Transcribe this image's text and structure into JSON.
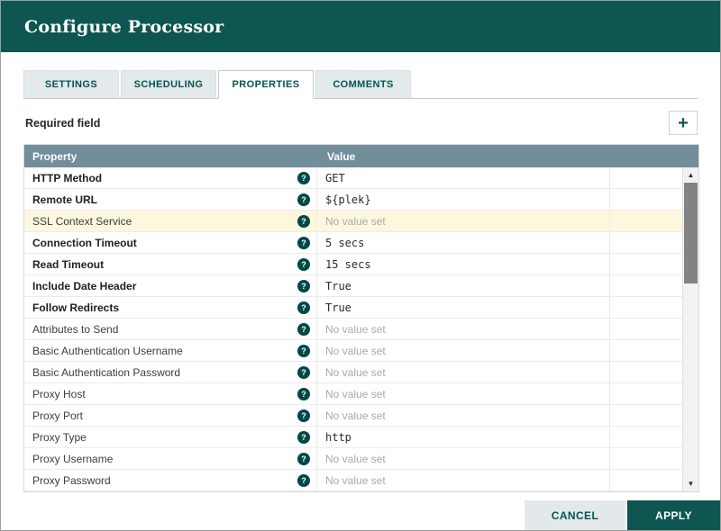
{
  "dialog": {
    "title": "Configure Processor"
  },
  "tabs": [
    {
      "label": "SETTINGS"
    },
    {
      "label": "SCHEDULING"
    },
    {
      "label": "PROPERTIES"
    },
    {
      "label": "COMMENTS"
    }
  ],
  "active_tab": "PROPERTIES",
  "toolbar": {
    "required_label": "Required field"
  },
  "icons": {
    "help": "?",
    "add": "+",
    "scroll_up": "▲",
    "scroll_down": "▼"
  },
  "table": {
    "columns": [
      "Property",
      "Value"
    ],
    "rows": [
      {
        "property": "HTTP Method",
        "required": true,
        "value": "GET",
        "empty": false,
        "highlighted": false
      },
      {
        "property": "Remote URL",
        "required": true,
        "value": "${plek}",
        "empty": false,
        "highlighted": false
      },
      {
        "property": "SSL Context Service",
        "required": false,
        "value": "No value set",
        "empty": true,
        "highlighted": true
      },
      {
        "property": "Connection Timeout",
        "required": true,
        "value": "5 secs",
        "empty": false,
        "highlighted": false
      },
      {
        "property": "Read Timeout",
        "required": true,
        "value": "15 secs",
        "empty": false,
        "highlighted": false
      },
      {
        "property": "Include Date Header",
        "required": true,
        "value": "True",
        "empty": false,
        "highlighted": false
      },
      {
        "property": "Follow Redirects",
        "required": true,
        "value": "True",
        "empty": false,
        "highlighted": false
      },
      {
        "property": "Attributes to Send",
        "required": false,
        "value": "No value set",
        "empty": true,
        "highlighted": false
      },
      {
        "property": "Basic Authentication Username",
        "required": false,
        "value": "No value set",
        "empty": true,
        "highlighted": false
      },
      {
        "property": "Basic Authentication Password",
        "required": false,
        "value": "No value set",
        "empty": true,
        "highlighted": false
      },
      {
        "property": "Proxy Host",
        "required": false,
        "value": "No value set",
        "empty": true,
        "highlighted": false
      },
      {
        "property": "Proxy Port",
        "required": false,
        "value": "No value set",
        "empty": true,
        "highlighted": false
      },
      {
        "property": "Proxy Type",
        "required": false,
        "value": "http",
        "empty": false,
        "highlighted": false
      },
      {
        "property": "Proxy Username",
        "required": false,
        "value": "No value set",
        "empty": true,
        "highlighted": false
      },
      {
        "property": "Proxy Password",
        "required": false,
        "value": "No value set",
        "empty": true,
        "highlighted": false
      }
    ]
  },
  "footer": {
    "cancel_label": "CANCEL",
    "apply_label": "APPLY"
  },
  "colors": {
    "header_bg": "#0d5651",
    "table_header_bg": "#728e9b",
    "accent_text": "#00564f",
    "row_highlight_bg": "#fdf8dd",
    "empty_value_text": "#a9a9a9",
    "help_icon_bg": "#004849",
    "cancel_button_bg": "#e3e8eb",
    "apply_button_bg": "#0d5651"
  }
}
